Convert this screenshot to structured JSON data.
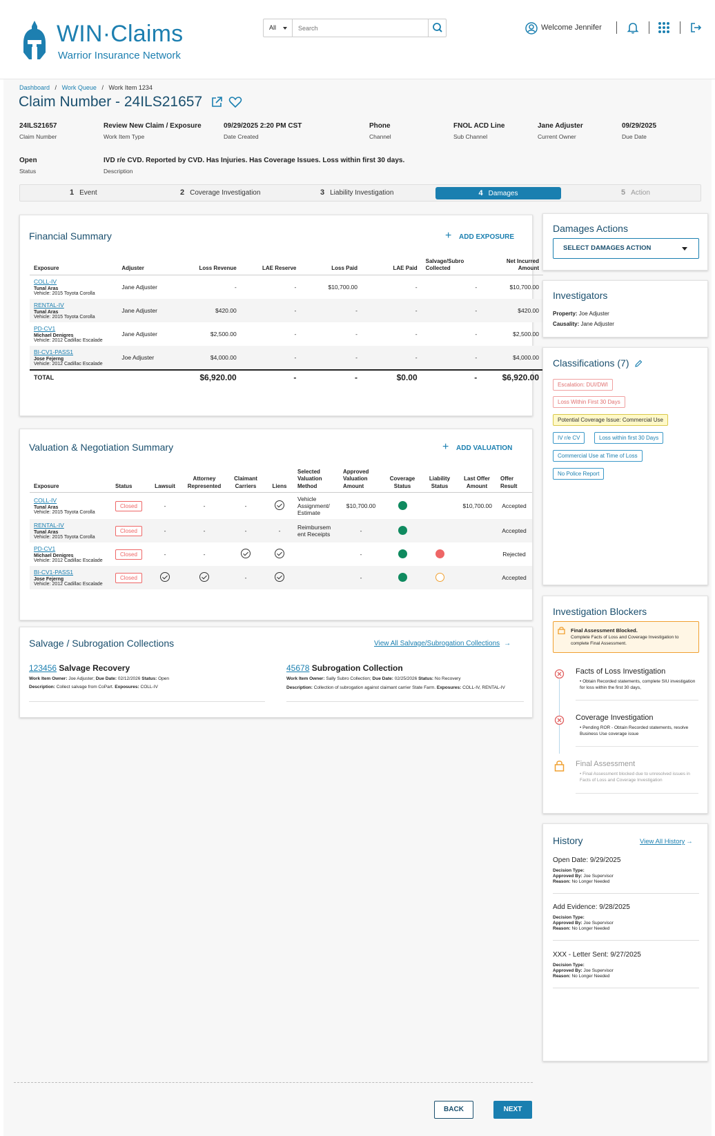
{
  "app": {
    "logo_title": "WIN·Claims",
    "logo_subtitle": "Warrior Insurance Network"
  },
  "search": {
    "scope": "All",
    "placeholder": "Search"
  },
  "user": {
    "welcome": "Welcome Jennifer"
  },
  "breadcrumb": {
    "dashboard": "Dashboard",
    "work_queue": "Work Queue",
    "current": "Work Item 1234"
  },
  "claim": {
    "title": "Claim Number - 24ILS21657",
    "fields": [
      {
        "value": "24ILS21657",
        "label": "Claim Number"
      },
      {
        "value": "Review New Claim / Exposure",
        "label": "Work Item Type"
      },
      {
        "value": "09/29/2025 2:20 PM CST",
        "label": "Date Created"
      },
      {
        "value": "Phone",
        "label": "Channel"
      },
      {
        "value": "FNOL ACD Line",
        "label": "Sub Channel"
      },
      {
        "value": "Jane Adjuster",
        "label": "Current Owner"
      },
      {
        "value": "09/29/2025",
        "label": "Due Date"
      }
    ],
    "status": {
      "value": "Open",
      "label": "Status"
    },
    "description": {
      "value": "IVD r/e CVD.  Reported by CVD. Has Injuries.  Has Coverage Issues.  Loss within first 30 days.",
      "label": "Description"
    }
  },
  "steps": [
    {
      "num": "1",
      "label": "Event"
    },
    {
      "num": "2",
      "label": "Coverage Investigation"
    },
    {
      "num": "3",
      "label": "Liability  Investigation"
    },
    {
      "num": "4",
      "label": "Damages"
    },
    {
      "num": "5",
      "label": "Action"
    }
  ],
  "financial": {
    "title": "Financial Summary",
    "add_label": "ADD EXPOSURE",
    "headers": [
      "Exposure",
      "Adjuster",
      "Loss Revenue",
      "LAE Reserve",
      "Loss Paid",
      "LAE Paid",
      "Salvage/Subro Collected",
      "Net Incurred Amount"
    ],
    "rows": [
      {
        "exposure": "COLL-IV",
        "name": "Tunal Aras",
        "vehicle": "Vehicle: 2015 Toyota Corolla",
        "adjuster": "Jane Adjuster",
        "loss_rev": "-",
        "lae_res": "-",
        "loss_paid": "$10,700.00",
        "lae_paid": "-",
        "salvage": "-",
        "net": "$10,700.00"
      },
      {
        "exposure": "RENTAL-IV",
        "name": "Tunal Aras",
        "vehicle": "Vehicle: 2015 Toyota Corolla",
        "adjuster": "Jane Adjuster",
        "loss_rev": "$420.00",
        "lae_res": "-",
        "loss_paid": "-",
        "lae_paid": "-",
        "salvage": "-",
        "net": "$420.00"
      },
      {
        "exposure": "PD-CV1",
        "name": "Michael Denigres",
        "vehicle": "Vehicle: 2012 Cadillac Escalade",
        "adjuster": "Jane Adjuster",
        "loss_rev": "$2,500.00",
        "lae_res": "-",
        "loss_paid": "-",
        "lae_paid": "-",
        "salvage": "-",
        "net": "$2,500.00"
      },
      {
        "exposure": "BI-CV1-PASS1",
        "name": "Jose Fejerng",
        "vehicle": "Vehicle: 2012 Cadillac Escalade",
        "adjuster": "Joe Adjuster",
        "loss_rev": "$4,000.00",
        "lae_res": "-",
        "loss_paid": "-",
        "lae_paid": "-",
        "salvage": "-",
        "net": "$4,000.00"
      }
    ],
    "total": {
      "label": "TOTAL",
      "loss_rev": "$6,920.00",
      "lae_res": "-",
      "loss_paid": "-",
      "lae_paid": "$0.00",
      "salvage": "-",
      "net": "$6,920.00"
    }
  },
  "valuation": {
    "title": "Valuation & Negotiation Summary",
    "add_label": "ADD VALUATION",
    "headers": [
      "Exposure",
      "Status",
      "Lawsuit",
      "Attorney Represented",
      "Claimant Carriers",
      "Liens",
      "Selected Valuation Method",
      "Approved Valuation Amount",
      "Coverage Status",
      "Liability Status",
      "Last Offer Amount",
      "Offer Result"
    ],
    "rows": [
      {
        "exposure": "COLL-IV",
        "name": "Tunal Aras",
        "vehicle": "Vehicle: 2015 Toyota Corolla",
        "status": "Closed",
        "lawsuit": "-",
        "attorney": "-",
        "carriers": "-",
        "liens": "check",
        "method": "Vehicle Assignment/ Estimate",
        "approved": "$10,700.00",
        "coverage": "green",
        "liability": "",
        "last_offer": "$10,700.00",
        "result": "Accepted"
      },
      {
        "exposure": "RENTAL-IV",
        "name": "Tunal Aras",
        "vehicle": "Vehicle: 2015 Toyota Corolla",
        "status": "Closed",
        "lawsuit": "-",
        "attorney": "-",
        "carriers": "-",
        "liens": "-",
        "method": "Reimbursem ent Receipts",
        "approved": "-",
        "coverage": "green",
        "liability": "",
        "last_offer": "",
        "result": "Accepted"
      },
      {
        "exposure": "PD-CV1",
        "name": "Michael Denigres",
        "vehicle": "Vehicle: 2012 Cadillac Escalade",
        "status": "Closed",
        "lawsuit": "-",
        "attorney": "-",
        "carriers": "check",
        "liens": "check",
        "method": "",
        "approved": "-",
        "coverage": "green",
        "liability": "red",
        "last_offer": "",
        "result": "Rejected"
      },
      {
        "exposure": "BI-CV1-PASS1",
        "name": "Jose Fejerng",
        "vehicle": "Vehicle: 2012 Cadillac Escalade",
        "status": "Closed",
        "lawsuit": "check",
        "attorney": "check",
        "carriers": "-",
        "liens": "check",
        "method": "",
        "approved": "-",
        "coverage": "green",
        "liability": "orange",
        "last_offer": "",
        "result": "Accepted"
      }
    ]
  },
  "salvage": {
    "title": "Salvage / Subrogation Collections",
    "view_all": "View All Salvage/Subrogation Collections",
    "items": [
      {
        "id": "123456",
        "name": "Salvage Recovery",
        "owner_label": "Work Item Owner:",
        "owner": "Joe Adjuster;",
        "due_label": "Due Date:",
        "due": "02/12/2026",
        "status_label": "Status:",
        "status": "Open",
        "desc_label": "Description:",
        "desc": "Collect salvage from CoPart.",
        "exp_label": "Exposures:",
        "exp": "COLL-IV"
      },
      {
        "id": "45678",
        "name": "Subrogation Collection",
        "owner_label": "Work Item Owner:",
        "owner": "Sally Subro Collection;",
        "due_label": "Due Date:",
        "due": "02/25/2026",
        "status_label": "Status:",
        "status": "No Recovery",
        "desc_label": "Description:",
        "desc": "Collection of subrogation against claimant carrier State Farm.",
        "exp_label": "Exposures:",
        "exp": "COLL-IV, RENTAL-IV"
      }
    ]
  },
  "damages_actions": {
    "title": "Damages Actions",
    "select_label": "SELECT DAMAGES ACTION"
  },
  "investigators": {
    "title": "Investigators",
    "property_label": "Property:",
    "property": "Joe Adjuster",
    "causality_label": "Causality:",
    "causality": "Jane Adjuster"
  },
  "classifications": {
    "title": "Classifications (7)",
    "tags": [
      {
        "label": "Escalation: DUI/DWI"
      },
      {
        "label": "Loss Within First 30 Days"
      },
      {
        "label": "Potential Coverage Issue: Commercial Use"
      },
      {
        "label": "IV r/e CV"
      },
      {
        "label": "Loss within first 30 Days"
      },
      {
        "label": "Commercial Use at Time of Loss"
      },
      {
        "label": "No Police Report"
      }
    ]
  },
  "blockers": {
    "title": "Investigation Blockers",
    "alert_title": "Final Assessment Blocked.",
    "alert_text": "Complete Facts of Loss and Coverage Investigation to complete Final Assessment.",
    "items": [
      {
        "title": "Facts of Loss Investigation",
        "text": "Obtain Recorded statements, complete SIU investigation for loss within the first 30 days,"
      },
      {
        "title": "Coverage Investigation",
        "text": "Pending ROR - Obtain Recorded statements, resolve Business Use coverage issue"
      },
      {
        "title": "Final Assessment",
        "text": "Final Assessment blocked due to unresolved issues in Facts of Loss and Coverage Investigation"
      }
    ]
  },
  "history": {
    "title": "History",
    "view_all": "View All History",
    "entries": [
      {
        "heading": "Open Date: 9/29/2025",
        "type_label": "Decision Type:",
        "approved_label": "Approved By:",
        "approved": "Joe Supervisor",
        "reason_label": "Reason:",
        "reason": "No Longer Needed"
      },
      {
        "heading": "Add Evidence: 9/28/2025",
        "type_label": "Decision Type:",
        "approved_label": "Approved By:",
        "approved": "Joe Supervisor",
        "reason_label": "Reason:",
        "reason": "No Longer Needed"
      },
      {
        "heading": "XXX - Letter Sent: 9/27/2025",
        "type_label": "Decision Type:",
        "approved_label": "Approved By:",
        "approved": "Joe Supervisor",
        "reason_label": "Reason:",
        "reason": "No Longer Needed"
      }
    ]
  },
  "footer": {
    "back": "BACK",
    "next": "NEXT"
  },
  "colors": {
    "primary": "#1a7fb0",
    "heading": "#1a4f6e",
    "success": "#0f8a5f",
    "danger": "#ee6666",
    "warning": "#f0a030"
  }
}
